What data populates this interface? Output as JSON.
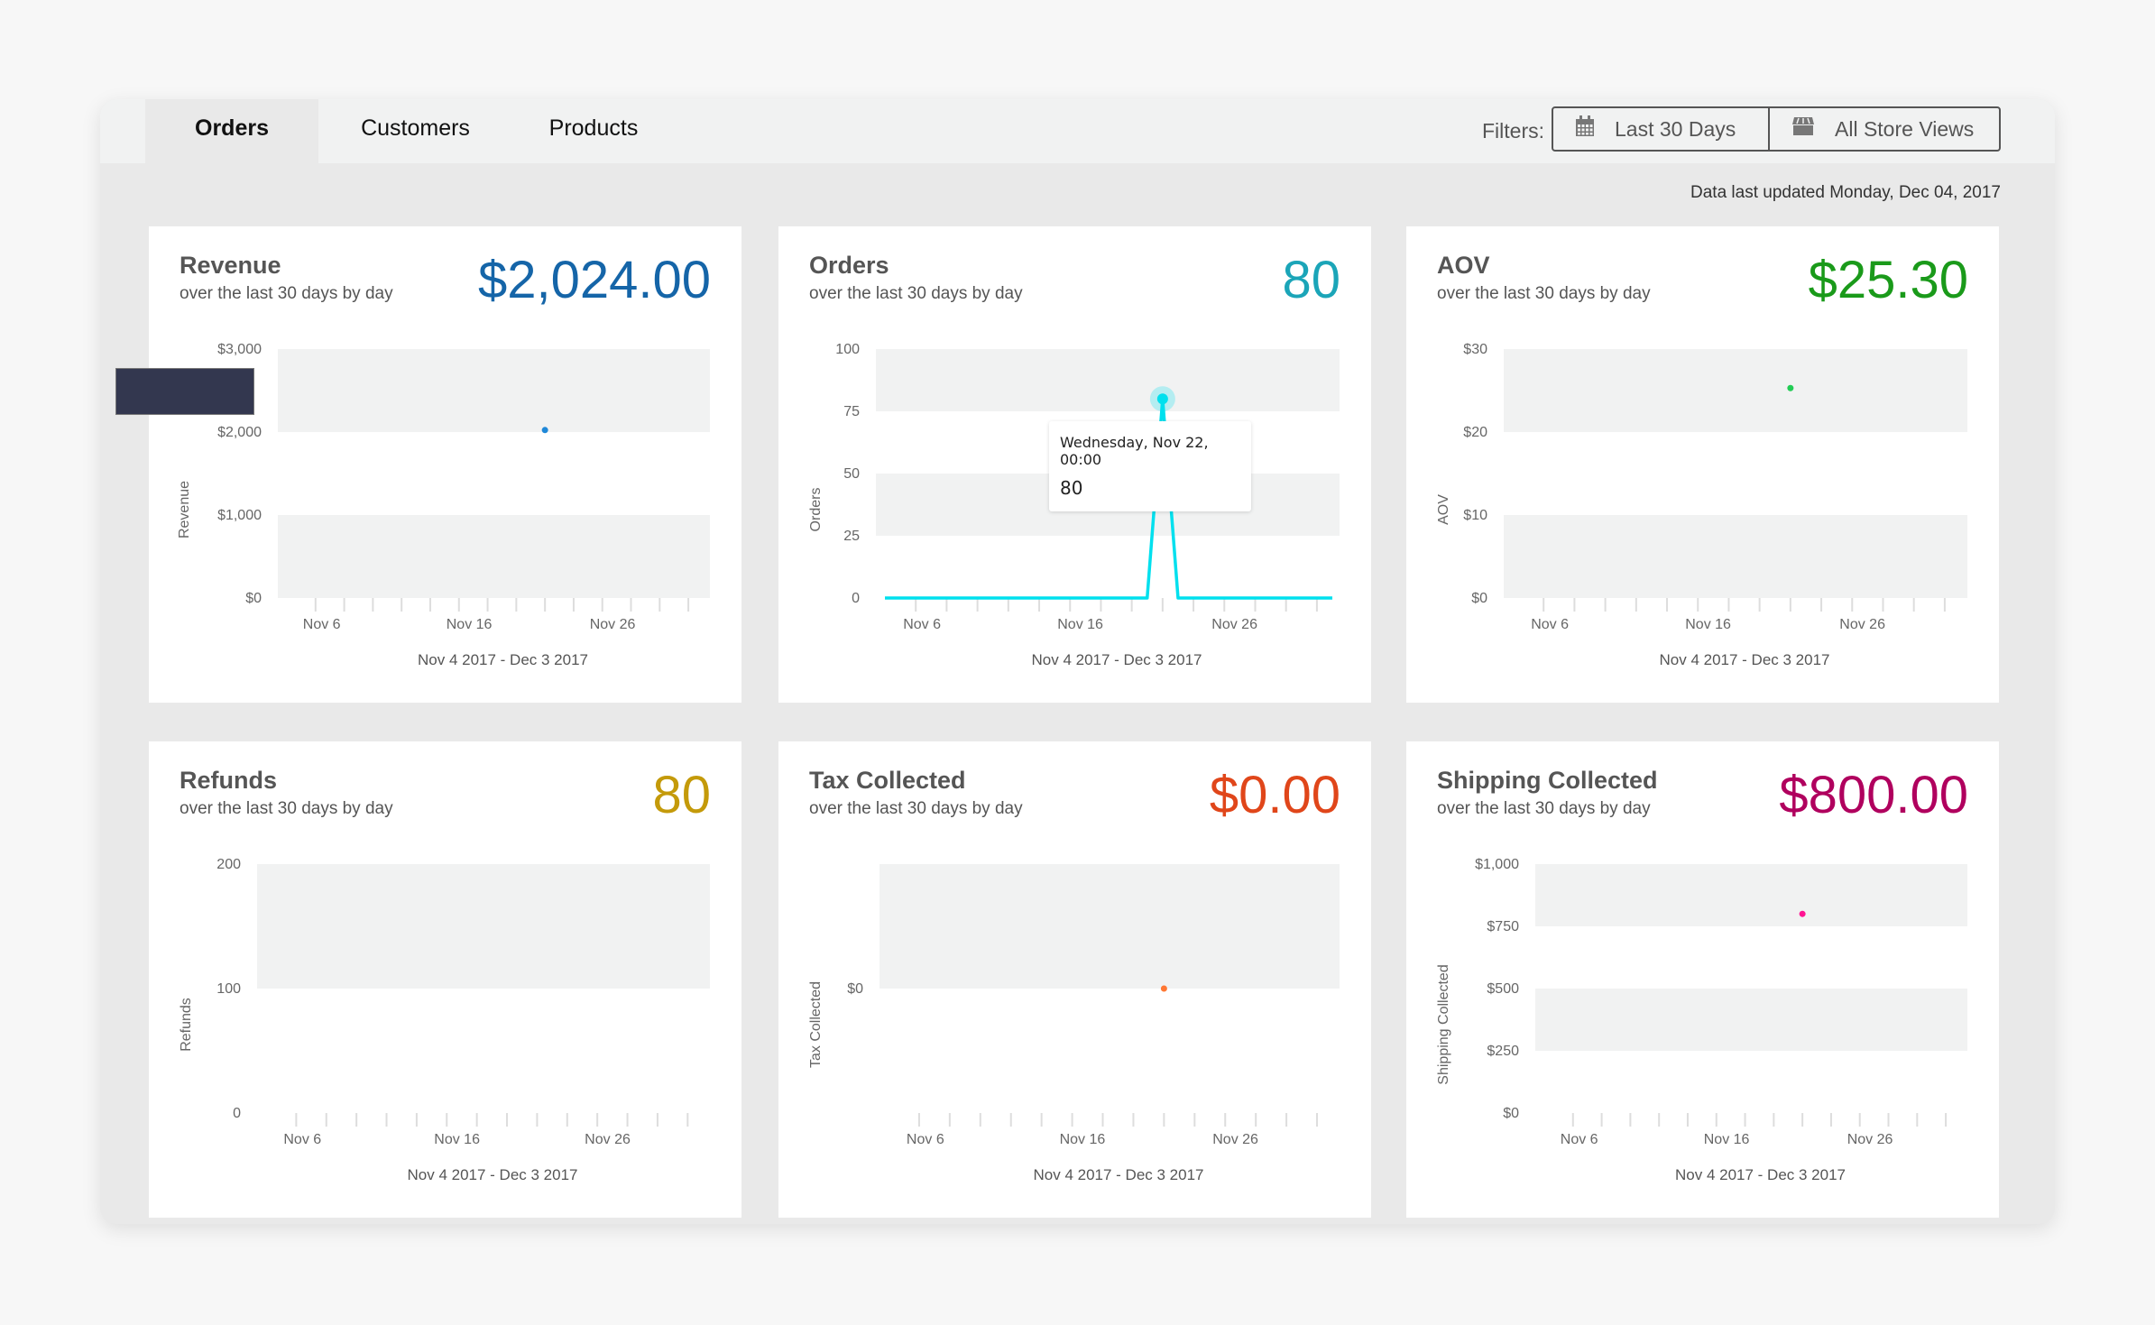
{
  "tabs": [
    {
      "label": "Orders",
      "active": true
    },
    {
      "label": "Customers",
      "active": false
    },
    {
      "label": "Products",
      "active": false
    }
  ],
  "filters": {
    "label": "Filters:",
    "date_range": {
      "label": "Last 30 Days",
      "icon": "calendar-icon"
    },
    "store_view": {
      "label": "All Store Views",
      "icon": "store-icon"
    }
  },
  "updated_text": "Data last updated Monday, Dec 04, 2017",
  "cards": [
    {
      "title": "Revenue",
      "subtitle": "over the last 30 days by day",
      "value": "$2,024.00",
      "color": "#1565a8"
    },
    {
      "title": "Orders",
      "subtitle": "over the last 30 days by day",
      "value": "80",
      "color": "#1ba5b8"
    },
    {
      "title": "AOV",
      "subtitle": "over the last 30 days by day",
      "value": "$25.30",
      "color": "#1a9a1a"
    },
    {
      "title": "Refunds",
      "subtitle": "over the last 30 days by day",
      "value": "80",
      "color": "#c49a0a"
    },
    {
      "title": "Tax Collected",
      "subtitle": "over the last 30 days by day",
      "value": "$0.00",
      "color": "#e0461a"
    },
    {
      "title": "Shipping Collected",
      "subtitle": "over the last 30 days by day",
      "value": "$800.00",
      "color": "#b0005e"
    }
  ],
  "tooltip": {
    "date": "Wednesday, Nov 22, 00:00",
    "value": "80"
  },
  "chart_data": [
    {
      "type": "scatter",
      "title": "Revenue",
      "ylabel": "Revenue",
      "xlabel": "Nov 4 2017 - Dec 3 2017",
      "x_ticks": [
        "Nov 6",
        "Nov 16",
        "Nov 26"
      ],
      "y_ticks": [
        "$0",
        "$1,000",
        "$2,000",
        "$3,000"
      ],
      "ylim": [
        0,
        3000
      ],
      "y_tick_values": [
        0,
        1000,
        2000,
        3000
      ],
      "xlim": [
        "2017-11-04",
        "2017-12-03"
      ],
      "points": [
        {
          "x": "2017-11-22",
          "y": 2024
        }
      ],
      "color": "#1f88d8"
    },
    {
      "type": "line",
      "title": "Orders",
      "ylabel": "Orders",
      "xlabel": "Nov 4 2017 - Dec 3 2017",
      "x_ticks": [
        "Nov 6",
        "Nov 16",
        "Nov 26"
      ],
      "y_ticks": [
        "0",
        "25",
        "50",
        "75",
        "100"
      ],
      "ylim": [
        0,
        100
      ],
      "y_tick_values": [
        0,
        25,
        50,
        75,
        100
      ],
      "xlim": [
        "2017-11-04",
        "2017-12-03"
      ],
      "points": [
        {
          "x": "2017-11-04",
          "y": 0
        },
        {
          "x": "2017-11-05",
          "y": 0
        },
        {
          "x": "2017-11-06",
          "y": 0
        },
        {
          "x": "2017-11-07",
          "y": 0
        },
        {
          "x": "2017-11-08",
          "y": 0
        },
        {
          "x": "2017-11-09",
          "y": 0
        },
        {
          "x": "2017-11-10",
          "y": 0
        },
        {
          "x": "2017-11-11",
          "y": 0
        },
        {
          "x": "2017-11-12",
          "y": 0
        },
        {
          "x": "2017-11-13",
          "y": 0
        },
        {
          "x": "2017-11-14",
          "y": 0
        },
        {
          "x": "2017-11-15",
          "y": 0
        },
        {
          "x": "2017-11-16",
          "y": 0
        },
        {
          "x": "2017-11-17",
          "y": 0
        },
        {
          "x": "2017-11-18",
          "y": 0
        },
        {
          "x": "2017-11-19",
          "y": 0
        },
        {
          "x": "2017-11-20",
          "y": 0
        },
        {
          "x": "2017-11-21",
          "y": 0
        },
        {
          "x": "2017-11-22",
          "y": 80
        },
        {
          "x": "2017-11-23",
          "y": 0
        },
        {
          "x": "2017-11-24",
          "y": 0
        },
        {
          "x": "2017-11-25",
          "y": 0
        },
        {
          "x": "2017-11-26",
          "y": 0
        },
        {
          "x": "2017-11-27",
          "y": 0
        },
        {
          "x": "2017-11-28",
          "y": 0
        },
        {
          "x": "2017-11-29",
          "y": 0
        },
        {
          "x": "2017-11-30",
          "y": 0
        },
        {
          "x": "2017-12-01",
          "y": 0
        },
        {
          "x": "2017-12-02",
          "y": 0
        },
        {
          "x": "2017-12-03",
          "y": 0
        }
      ],
      "highlight": {
        "x": "2017-11-22",
        "y": 80
      },
      "color": "#00e0ee"
    },
    {
      "type": "scatter",
      "title": "AOV",
      "ylabel": "AOV",
      "xlabel": "Nov 4 2017 - Dec 3 2017",
      "x_ticks": [
        "Nov 6",
        "Nov 16",
        "Nov 26"
      ],
      "y_ticks": [
        "$0",
        "$10",
        "$20",
        "$30"
      ],
      "ylim": [
        0,
        30
      ],
      "y_tick_values": [
        0,
        10,
        20,
        30
      ],
      "xlim": [
        "2017-11-04",
        "2017-12-03"
      ],
      "points": [
        {
          "x": "2017-11-22",
          "y": 25.3
        }
      ],
      "color": "#22cc55"
    },
    {
      "type": "scatter",
      "title": "Refunds",
      "ylabel": "Refunds",
      "xlabel": "Nov 4 2017 - Dec 3 2017",
      "x_ticks": [
        "Nov 6",
        "Nov 16",
        "Nov 26"
      ],
      "y_ticks": [
        "0",
        "100",
        "200"
      ],
      "ylim": [
        0,
        200
      ],
      "y_tick_values": [
        0,
        100,
        200
      ],
      "xlim": [
        "2017-11-04",
        "2017-12-03"
      ],
      "points": [],
      "color": "#c49a0a"
    },
    {
      "type": "scatter",
      "title": "Tax Collected",
      "ylabel": "Tax Collected",
      "xlabel": "Nov 4 2017 - Dec 3 2017",
      "x_ticks": [
        "Nov 6",
        "Nov 16",
        "Nov 26"
      ],
      "y_ticks": [
        "$0"
      ],
      "ylim": [
        -1,
        1
      ],
      "y_tick_values": [
        0
      ],
      "xlim": [
        "2017-11-04",
        "2017-12-03"
      ],
      "points": [
        {
          "x": "2017-11-22",
          "y": 0
        }
      ],
      "color": "#ff7733"
    },
    {
      "type": "scatter",
      "title": "Shipping Collected",
      "ylabel": "Shipping Collected",
      "xlabel": "Nov 4 2017 - Dec 3 2017",
      "x_ticks": [
        "Nov 6",
        "Nov 16",
        "Nov 26"
      ],
      "y_ticks": [
        "$0",
        "$250",
        "$500",
        "$750",
        "$1,000"
      ],
      "ylim": [
        0,
        1000
      ],
      "y_tick_values": [
        0,
        250,
        500,
        750,
        1000
      ],
      "xlim": [
        "2017-11-04",
        "2017-12-03"
      ],
      "points": [
        {
          "x": "2017-11-22",
          "y": 800
        }
      ],
      "color": "#ff1493"
    }
  ]
}
